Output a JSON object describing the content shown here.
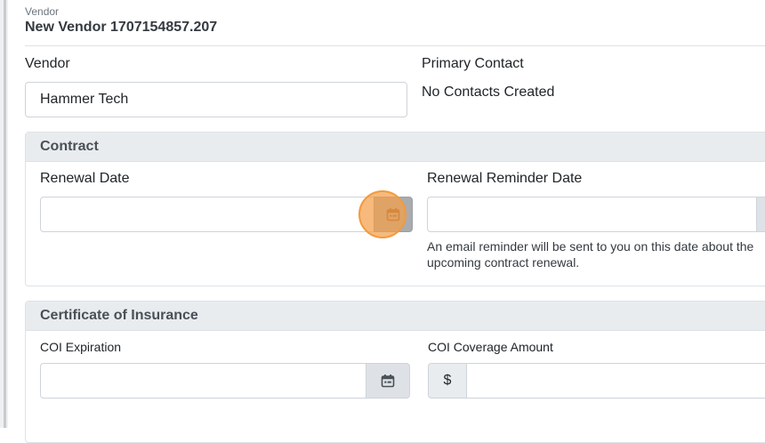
{
  "header": {
    "entity_type": "Vendor",
    "title": "New Vendor 1707154857.207"
  },
  "vendor_field": {
    "label": "Vendor",
    "value": "Hammer Tech"
  },
  "primary_contact": {
    "label": "Primary Contact",
    "value": "No Contacts Created"
  },
  "contract_section": {
    "title": "Contract",
    "renewal_date": {
      "label": "Renewal Date",
      "value": ""
    },
    "renewal_reminder_date": {
      "label": "Renewal Reminder Date",
      "value": "",
      "help": "An email reminder will be sent to you on this date about the upcoming contract renewal."
    }
  },
  "insurance_section": {
    "title": "Certificate of Insurance",
    "coi_expiration": {
      "label": "COI Expiration",
      "value": ""
    },
    "coi_coverage_amount": {
      "label": "COI Coverage Amount",
      "prefix": "$",
      "value": ""
    }
  },
  "icons": {
    "calendar": "calendar-icon"
  },
  "colors": {
    "click_indicator": "#f39a3c",
    "section_header_bg": "#e9ecef"
  }
}
